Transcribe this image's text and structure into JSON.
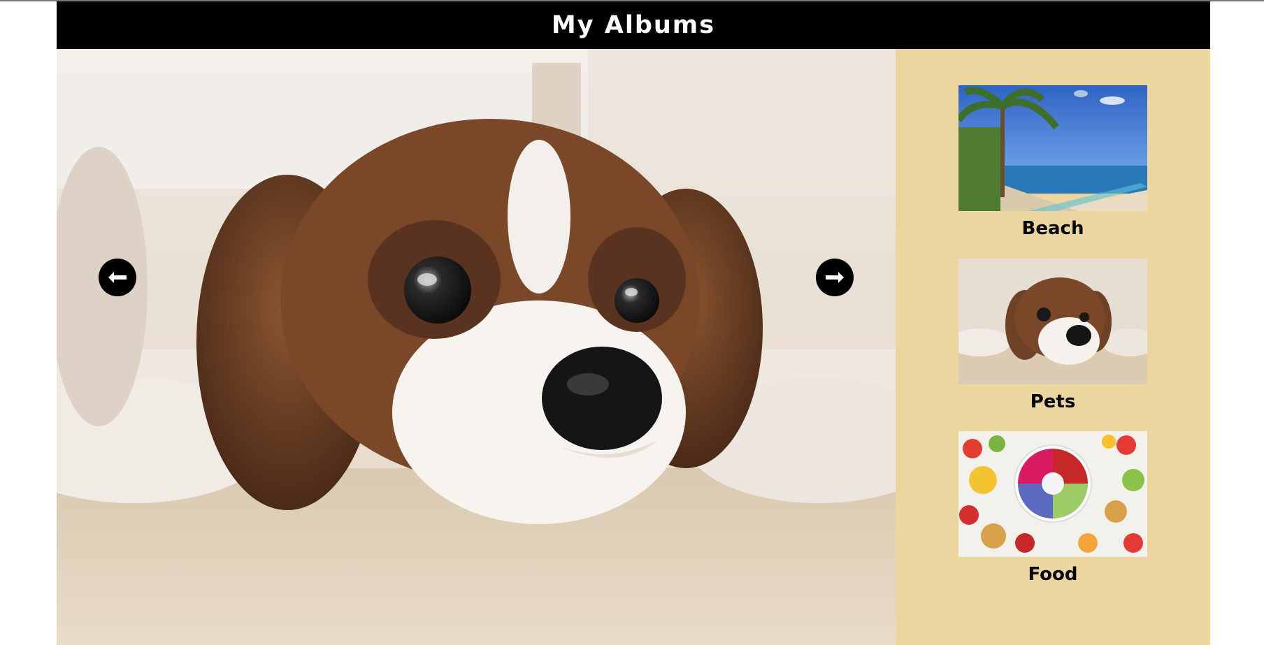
{
  "header": {
    "title": "My Albums"
  },
  "viewer": {
    "current_image": "pet-dog-photo",
    "prev_icon": "arrow-left-icon",
    "next_icon": "arrow-right-icon"
  },
  "albums": [
    {
      "label": "Beach",
      "thumbnail": "beach-photo"
    },
    {
      "label": "Pets",
      "thumbnail": "pet-dog-photo"
    },
    {
      "label": "Food",
      "thumbnail": "food-photo"
    }
  ],
  "colors": {
    "header_bg": "#000000",
    "header_text": "#ffffff",
    "sidebar_bg": "#ecd6a0",
    "nav_button": "#000000"
  }
}
